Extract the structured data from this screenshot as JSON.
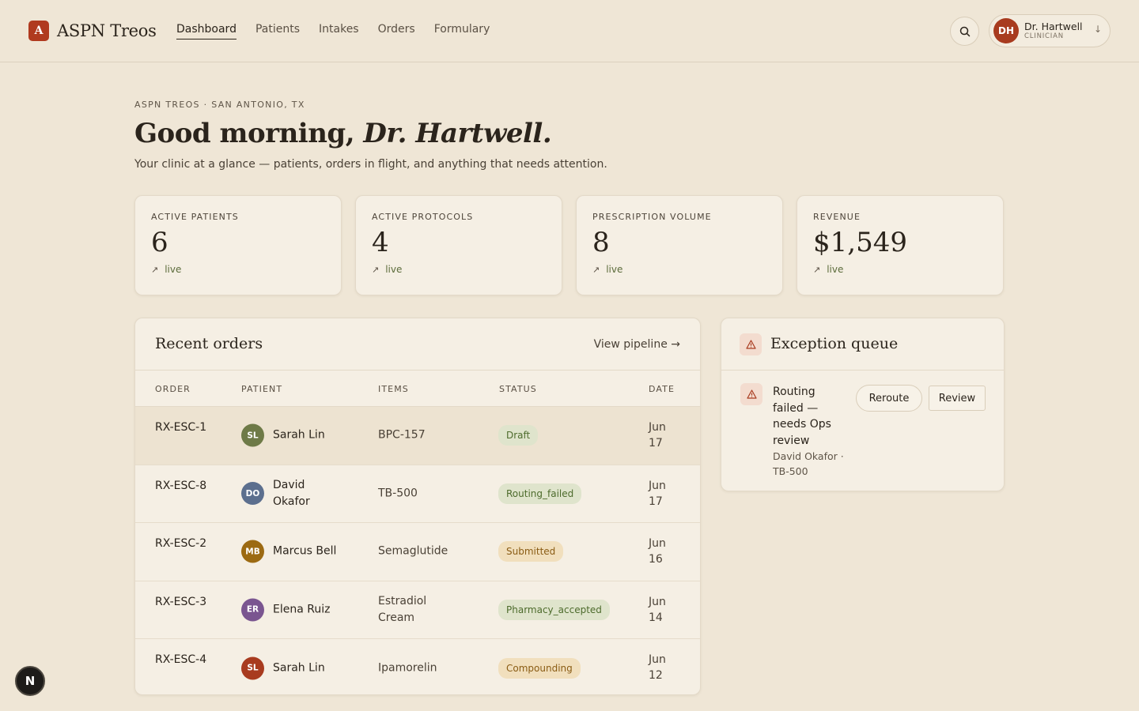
{
  "brand": {
    "mark": "A",
    "name": "ASPN Treos",
    "accent": "#b03a1f"
  },
  "nav": [
    {
      "label": "Dashboard",
      "active": true
    },
    {
      "label": "Patients",
      "active": false
    },
    {
      "label": "Intakes",
      "active": false
    },
    {
      "label": "Orders",
      "active": false
    },
    {
      "label": "Formulary",
      "active": false
    }
  ],
  "header": {
    "search_icon": "search-icon"
  },
  "user": {
    "initials": "DH",
    "name": "Dr. Hartwell",
    "role": "CLINICIAN",
    "chevron": "↓"
  },
  "page": {
    "eyebrow": "ASPN TREOS · SAN ANTONIO, TX",
    "greeting_prefix": "Good morning,",
    "greeting_name": "Dr. Hartwell.",
    "subtitle": "Your clinic at a glance — patients, orders in flight, and anything that needs attention."
  },
  "stats": [
    {
      "label": "ACTIVE PATIENTS",
      "value": "6",
      "trend": "live"
    },
    {
      "label": "ACTIVE PROTOCOLS",
      "value": "4",
      "trend": "live"
    },
    {
      "label": "PRESCRIPTION VOLUME",
      "value": "8",
      "trend": "live"
    },
    {
      "label": "REVENUE",
      "value": "$1,549",
      "trend": "live"
    }
  ],
  "orders": {
    "title": "Recent orders",
    "view_link": "View pipeline →",
    "columns": [
      "ORDER",
      "PATIENT",
      "ITEMS",
      "STATUS",
      "DATE"
    ],
    "rows": [
      {
        "order": "RX-ESC-1",
        "initials": "SL",
        "avatar_color": "#6e7a47",
        "patient": "Sarah Lin",
        "items": "BPC-157",
        "status": "Draft",
        "tone": "green",
        "date": "Jun 17"
      },
      {
        "order": "RX-ESC-8",
        "initials": "DO",
        "avatar_color": "#5c6f8e",
        "patient": "David Okafor",
        "items": "TB-500",
        "status": "Routing_failed",
        "tone": "green",
        "date": "Jun 17"
      },
      {
        "order": "RX-ESC-2",
        "initials": "MB",
        "avatar_color": "#9c6a12",
        "patient": "Marcus Bell",
        "items": "Semaglutide",
        "status": "Submitted",
        "tone": "amber",
        "date": "Jun 16"
      },
      {
        "order": "RX-ESC-3",
        "initials": "ER",
        "avatar_color": "#7a5590",
        "patient": "Elena Ruiz",
        "items": "Estradiol Cream",
        "status": "Pharmacy_accepted",
        "tone": "green",
        "date": "Jun 14"
      },
      {
        "order": "RX-ESC-4",
        "initials": "SL",
        "avatar_color": "#a83b1f",
        "patient": "Sarah Lin",
        "items": "Ipamorelin",
        "status": "Compounding",
        "tone": "amber",
        "date": "Jun 12"
      }
    ]
  },
  "exceptions": {
    "title": "Exception queue",
    "items": [
      {
        "text": "Routing failed — needs Ops review",
        "meta": "David Okafor · TB-500",
        "actions": [
          "Reroute",
          "Review"
        ]
      }
    ]
  },
  "fab": {
    "label": "N"
  }
}
